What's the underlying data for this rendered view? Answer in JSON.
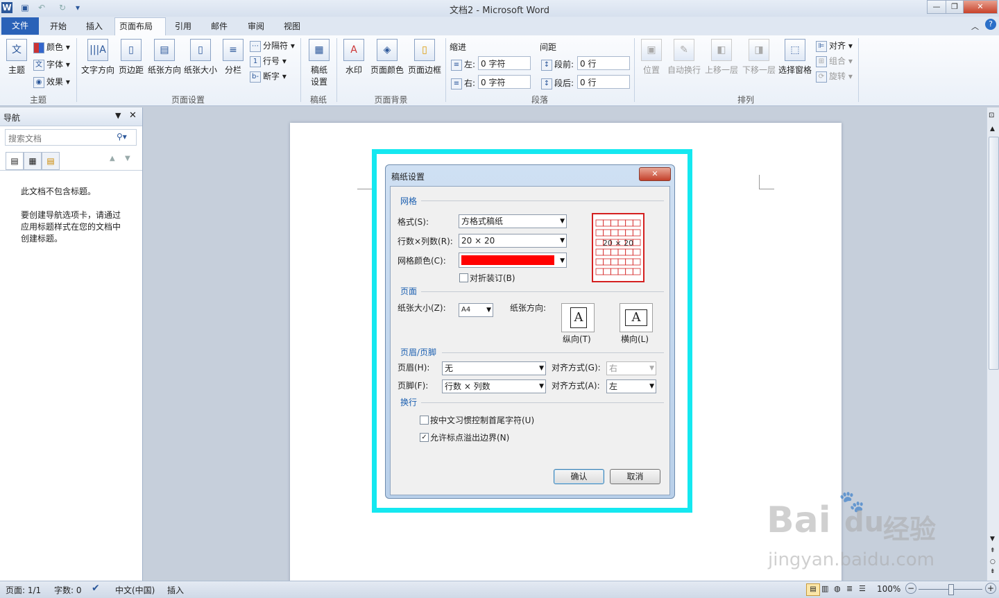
{
  "window": {
    "title": "文档2 - Microsoft Word"
  },
  "quick_access": [
    "word-logo-icon",
    "save-icon",
    "undo-icon",
    "redo-icon",
    "customize-icon"
  ],
  "tabs": [
    {
      "label": "文件"
    },
    {
      "label": "开始"
    },
    {
      "label": "插入"
    },
    {
      "label": "页面布局"
    },
    {
      "label": "引用"
    },
    {
      "label": "邮件"
    },
    {
      "label": "审阅"
    },
    {
      "label": "视图"
    }
  ],
  "ribbon": {
    "theme_group": {
      "label": "主题",
      "theme": "主题",
      "colors": "颜色",
      "fonts": "字体",
      "effects": "效果"
    },
    "page_setup_group": {
      "label": "页面设置",
      "text_direction": "文字方向",
      "margins": "页边距",
      "orientation": "纸张方向",
      "size": "纸张大小",
      "columns": "分栏",
      "breaks": "分隔符",
      "line_numbers": "行号",
      "hyphenation": "断字"
    },
    "manuscript_group": {
      "label": "稿纸",
      "btn": "稿纸\n设置",
      "btn_line1": "稿纸",
      "btn_line2": "设置"
    },
    "background_group": {
      "label": "页面背景",
      "watermark": "水印",
      "page_color": "页面颜色",
      "page_borders": "页面边框"
    },
    "paragraph_group": {
      "label": "段落",
      "indent": "缩进",
      "spacing": "间距",
      "left": "左:",
      "right": "右:",
      "before": "段前:",
      "after": "段后:",
      "left_val": "0 字符",
      "right_val": "0 字符",
      "before_val": "0 行",
      "after_val": "0 行"
    },
    "arrange_group": {
      "label": "排列",
      "position": "位置",
      "wrap": "自动换行",
      "forward": "上移一层",
      "backward": "下移一层",
      "selection_pane": "选择窗格",
      "align": "对齐",
      "group": "组合",
      "rotate": "旋转"
    }
  },
  "nav": {
    "title": "导航",
    "search_placeholder": "搜索文档",
    "no_headings": "此文档不包含标题。",
    "hint": [
      "要创建导航选项卡，请通过",
      "应用标题样式在您的文档中",
      "创建标题。"
    ]
  },
  "dialog": {
    "title": "稿纸设置",
    "grid_section": "网格",
    "style_label": "格式(S):",
    "style_value": "方格式稿纸",
    "rows_cols_label": "行数×列数(R):",
    "rows_cols_value": "20 × 20",
    "grid_color_label": "网格颜色(C):",
    "grid_color": "#ff0000",
    "fold_binding": "对折装订(B)",
    "preview_text": "20 × 20",
    "page_section": "页面",
    "paper_size_label": "纸张大小(Z):",
    "paper_size_value": "A4",
    "orientation_label": "纸张方向:",
    "portrait": "纵向(T)",
    "landscape": "横向(L)",
    "orient_glyph": "A",
    "header_footer_section": "页眉/页脚",
    "header_label": "页眉(H):",
    "header_value": "无",
    "header_align_label": "对齐方式(G):",
    "header_align_value": "右",
    "footer_label": "页脚(F):",
    "footer_value": "行数 × 列数",
    "footer_align_label": "对齐方式(A):",
    "footer_align_value": "左",
    "wrap_section": "换行",
    "opt1": "按中文习惯控制首尾字符(U)",
    "opt1_checked": false,
    "opt2": "允许标点溢出边界(N)",
    "opt2_checked": true,
    "ok": "确认",
    "cancel": "取消",
    "close_glyph": "✕"
  },
  "status": {
    "page": "页面: 1/1",
    "words": "字数: 0",
    "language": "中文(中国)",
    "mode": "插入",
    "zoom": "100%"
  },
  "watermark": {
    "brand": "Bai",
    "brand2": "du",
    "cn": "经验",
    "url": "jingyan.baidu.com"
  },
  "colors": {
    "highlight": "#14e8f0",
    "file_tab": "#2a62b8",
    "grid_red": "#d42020"
  }
}
